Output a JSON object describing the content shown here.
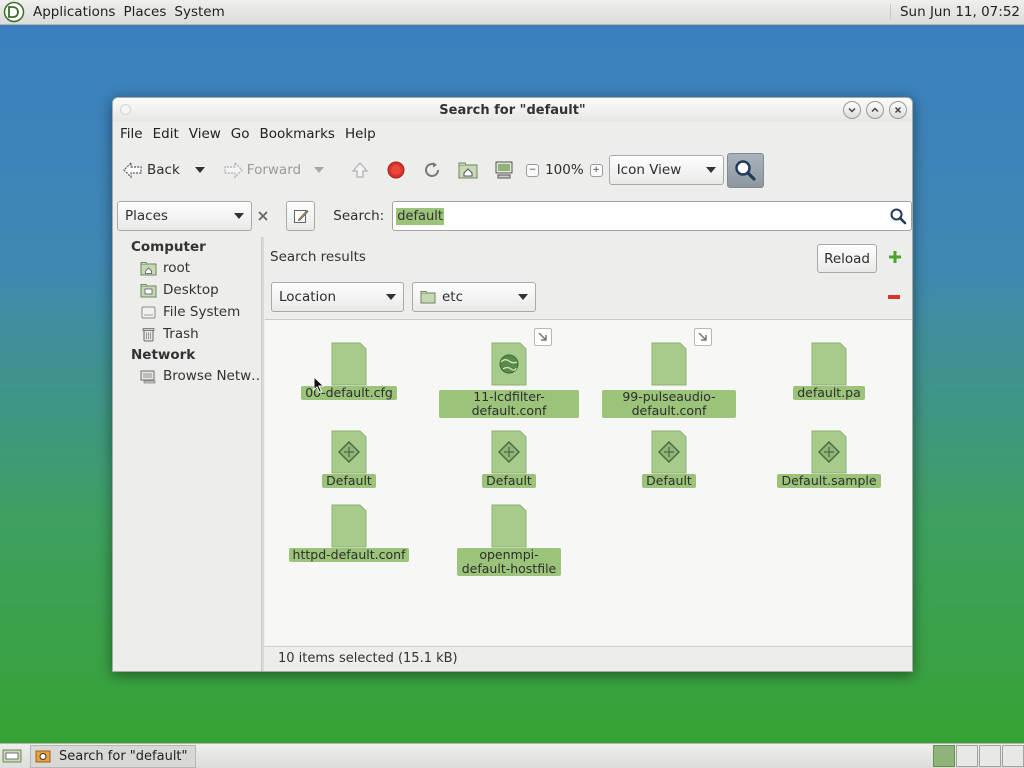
{
  "top_panel": {
    "menus": [
      "Applications",
      "Places",
      "System"
    ],
    "clock": "Sun Jun 11, 07:52"
  },
  "window": {
    "title": "Search for \"default\"",
    "menus": [
      "File",
      "Edit",
      "View",
      "Go",
      "Bookmarks",
      "Help"
    ],
    "toolbar": {
      "back": "Back",
      "forward": "Forward",
      "zoom": "100%",
      "view_mode": "Icon View"
    },
    "location_bar": {
      "places": "Places",
      "search_label": "Search:",
      "search_value": "default"
    },
    "sidebar": {
      "computer_heading": "Computer",
      "computer_items": [
        {
          "label": "root",
          "icon": "home-folder-icon"
        },
        {
          "label": "Desktop",
          "icon": "desktop-folder-icon"
        },
        {
          "label": "File System",
          "icon": "drive-icon"
        },
        {
          "label": "Trash",
          "icon": "trash-icon"
        }
      ],
      "network_heading": "Network",
      "network_items": [
        {
          "label": "Browse Netw…",
          "icon": "network-icon"
        }
      ]
    },
    "content": {
      "heading": "Search results",
      "reload": "Reload",
      "criteria_type": "Location",
      "criteria_folder": "etc",
      "files": [
        {
          "name": "00-default.cfg",
          "icon": "text-file-icon",
          "link": false
        },
        {
          "name": "11-lcdfilter-default.conf",
          "icon": "web-file-icon",
          "link": true
        },
        {
          "name": "99-pulseaudio-default.conf",
          "icon": "text-file-icon",
          "link": true
        },
        {
          "name": "default.pa",
          "icon": "text-file-icon",
          "link": false
        },
        {
          "name": "Default",
          "icon": "script-file-icon",
          "link": false
        },
        {
          "name": "Default",
          "icon": "script-file-icon",
          "link": false
        },
        {
          "name": "Default",
          "icon": "script-file-icon",
          "link": false
        },
        {
          "name": "Default.sample",
          "icon": "script-file-icon",
          "link": false
        },
        {
          "name": "httpd-default.conf",
          "icon": "text-file-icon",
          "link": false
        },
        {
          "name": "openmpi-default-hostfile",
          "icon": "text-file-icon",
          "link": false
        }
      ],
      "status": "10 items selected (15.1 kB)"
    }
  },
  "bottom_panel": {
    "task": "Search for \"default\"",
    "workspaces": 4
  },
  "colors": {
    "selection": "#9bc47a",
    "file_icon": "#a6cb8a",
    "accent_green": "#4aa52e",
    "remove_red": "#d8352a"
  }
}
